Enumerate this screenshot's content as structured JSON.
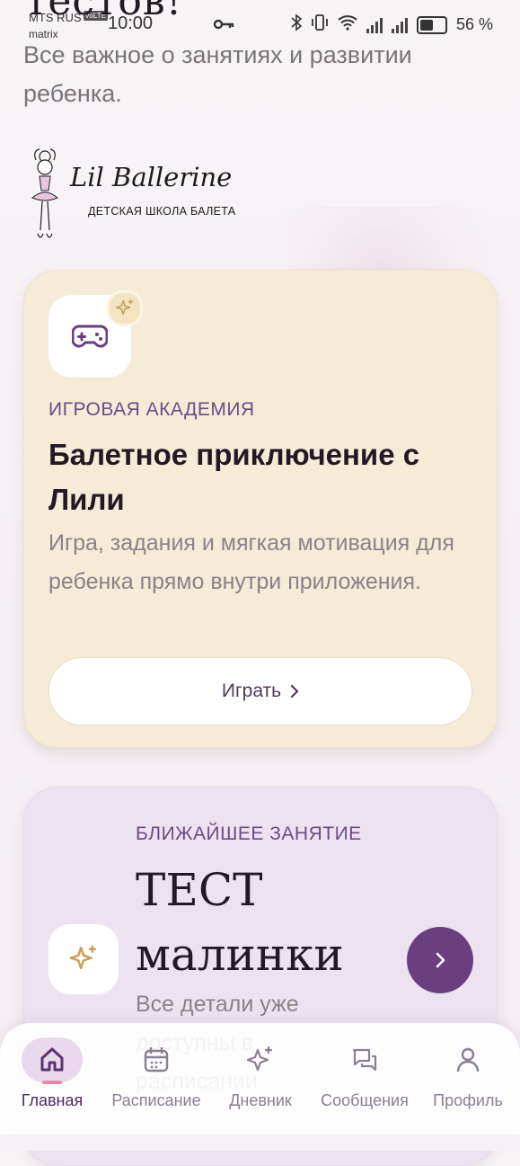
{
  "status_bar": {
    "carrier": "MTS RUS",
    "volte": "VoLTE",
    "wifi_name": "matrix",
    "time": "10:00",
    "battery_percent": "56 %"
  },
  "header": {
    "title_cut": "тестов!",
    "subtitle": "Все важное о занятиях и развитии ребенка."
  },
  "logo": {
    "title": "Lil Ballerine",
    "subtitle": "ДЕТСКАЯ ШКОЛА БАЛЕТА"
  },
  "game_card": {
    "eyebrow": "ИГРОВАЯ АКАДЕМИЯ",
    "title": "Балетное приключение с Лили",
    "description": "Игра, задания и мягкая мотивация для ребенка прямо внутри приложения.",
    "button_label": "Играть",
    "icon": "gamepad-icon",
    "badge_icon": "sparkle-icon"
  },
  "lesson_card": {
    "eyebrow": "БЛИЖАЙШЕЕ ЗАНЯТИЕ",
    "title": "ТЕСТ малинки",
    "description": "Все детали уже доступны в расписании",
    "icon": "sparkle-icon"
  },
  "tabbar": {
    "items": [
      {
        "label": "Главная",
        "icon": "home-icon",
        "active": true
      },
      {
        "label": "Расписание",
        "icon": "calendar-icon",
        "active": false
      },
      {
        "label": "Дневник",
        "icon": "sparkle-icon",
        "active": false
      },
      {
        "label": "Сообщения",
        "icon": "chat-icon",
        "active": false
      },
      {
        "label": "Профиль",
        "icon": "profile-icon",
        "active": false
      }
    ]
  },
  "colors": {
    "accent": "#6b3f7f",
    "game_card_bg": "#f5ecd8",
    "lesson_card_bg": "#ede3f0",
    "eyebrow": "#6b4a86"
  }
}
